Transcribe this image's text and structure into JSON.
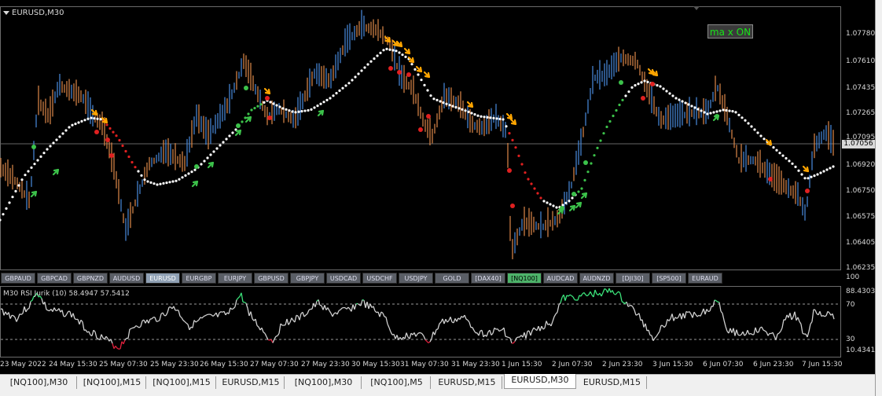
{
  "window": {
    "title": "EURUSD,M30"
  },
  "indicator_badge": "ma x ON",
  "price_axis": [
    "1.07780",
    "1.07610",
    "1.07435",
    "1.07265",
    "1.07095",
    "1.06920",
    "1.06750",
    "1.06575",
    "1.06405",
    "1.06235"
  ],
  "current_price": "1.07056",
  "symbols": [
    {
      "label": "GBPAUD",
      "state": "normal"
    },
    {
      "label": "GBPCAD",
      "state": "normal"
    },
    {
      "label": "GBPNZD",
      "state": "normal"
    },
    {
      "label": "AUDUSD",
      "state": "normal"
    },
    {
      "label": "EURUSD",
      "state": "active"
    },
    {
      "label": "EURGBP",
      "state": "normal"
    },
    {
      "label": "EURJPY",
      "state": "normal"
    },
    {
      "label": "GBPUSD",
      "state": "normal"
    },
    {
      "label": "GBPJPY",
      "state": "normal"
    },
    {
      "label": "USDCAD",
      "state": "normal"
    },
    {
      "label": "USDCHF",
      "state": "normal"
    },
    {
      "label": "USDJPY",
      "state": "normal"
    },
    {
      "label": "GOLD",
      "state": "normal"
    },
    {
      "label": "[DAX40]",
      "state": "normal"
    },
    {
      "label": "[NQ100]",
      "state": "highlight"
    },
    {
      "label": "AUDCAD",
      "state": "normal"
    },
    {
      "label": "AUDNZD",
      "state": "normal"
    },
    {
      "label": "[DJI30]",
      "state": "normal"
    },
    {
      "label": "[SP500]",
      "state": "normal"
    },
    {
      "label": "EURAUD",
      "state": "normal"
    }
  ],
  "rsi": {
    "label": "M30  RSI Jurik (10) 58.4947 57.5412",
    "scale_top": "100",
    "scale": [
      "88.4303",
      "70",
      "30",
      "10.4341"
    ]
  },
  "time_axis": [
    "23 May 2022",
    "24 May 15:30",
    "25 May 07:30",
    "25 May 23:30",
    "26 May 15:30",
    "27 May 07:30",
    "27 May 23:30",
    "30 May 15:30",
    "31 May 07:30",
    "31 May 23:30",
    "1 Jun 15:30",
    "2 Jun 07:30",
    "2 Jun 23:30",
    "3 Jun 15:30",
    "6 Jun 07:30",
    "6 Jun 23:30",
    "7 Jun 15:30"
  ],
  "tabs": [
    {
      "label": "[NQ100],M30",
      "active": false
    },
    {
      "label": "[NQ100],M15",
      "active": false
    },
    {
      "label": "[NQ100],M15",
      "active": false
    },
    {
      "label": "EURUSD,M15",
      "active": false
    },
    {
      "label": "[NQ100],M30",
      "active": false
    },
    {
      "label": "[NQ100],M5",
      "active": false
    },
    {
      "label": "EURUSD,M15",
      "active": false
    },
    {
      "label": "EURUSD,M30",
      "active": true
    },
    {
      "label": "EURUSD,M15",
      "active": false
    }
  ],
  "colors": {
    "bull": "#4a8de0",
    "bear": "#e08a4a",
    "ma": "#ffffff",
    "ma_up": "#3cc24a",
    "ma_down": "#e02020",
    "arrow_sell": "#ffa500",
    "arrow_buy": "#3cc24a",
    "rsi_line": "#cfcfcf",
    "rsi_overbought": "#3be27a",
    "rsi_oversold": "#e0203c"
  }
}
